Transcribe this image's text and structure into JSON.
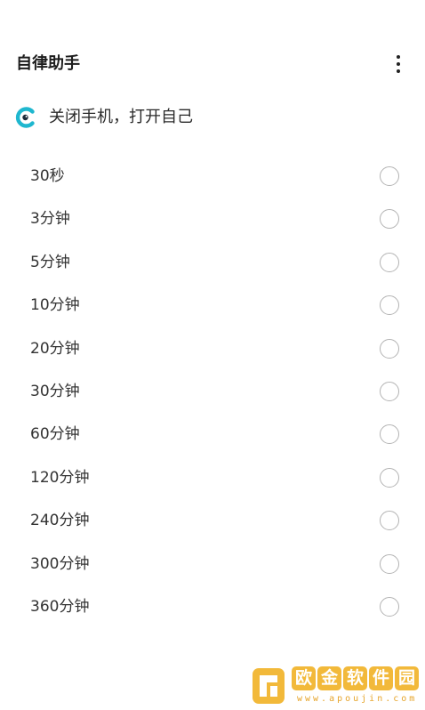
{
  "app_bar": {
    "title": "自律助手",
    "more_icon": "more-vertical-icon"
  },
  "header": {
    "logo_icon": "app-logo-icon",
    "logo_color": "#1fb7cf",
    "subtitle": "关闭手机，打开自己"
  },
  "options": [
    {
      "label": "30秒",
      "selected": false
    },
    {
      "label": "3分钟",
      "selected": false
    },
    {
      "label": "5分钟",
      "selected": false
    },
    {
      "label": "10分钟",
      "selected": false
    },
    {
      "label": "20分钟",
      "selected": false
    },
    {
      "label": "30分钟",
      "selected": false
    },
    {
      "label": "60分钟",
      "selected": false
    },
    {
      "label": "120分钟",
      "selected": false
    },
    {
      "label": "240分钟",
      "selected": false
    },
    {
      "label": "300分钟",
      "selected": false
    },
    {
      "label": "360分钟",
      "selected": false
    }
  ],
  "watermark": {
    "chars": [
      "欧",
      "金",
      "软",
      "件",
      "园"
    ],
    "url": "www.apoujin.com",
    "color": "#f2b93a"
  }
}
